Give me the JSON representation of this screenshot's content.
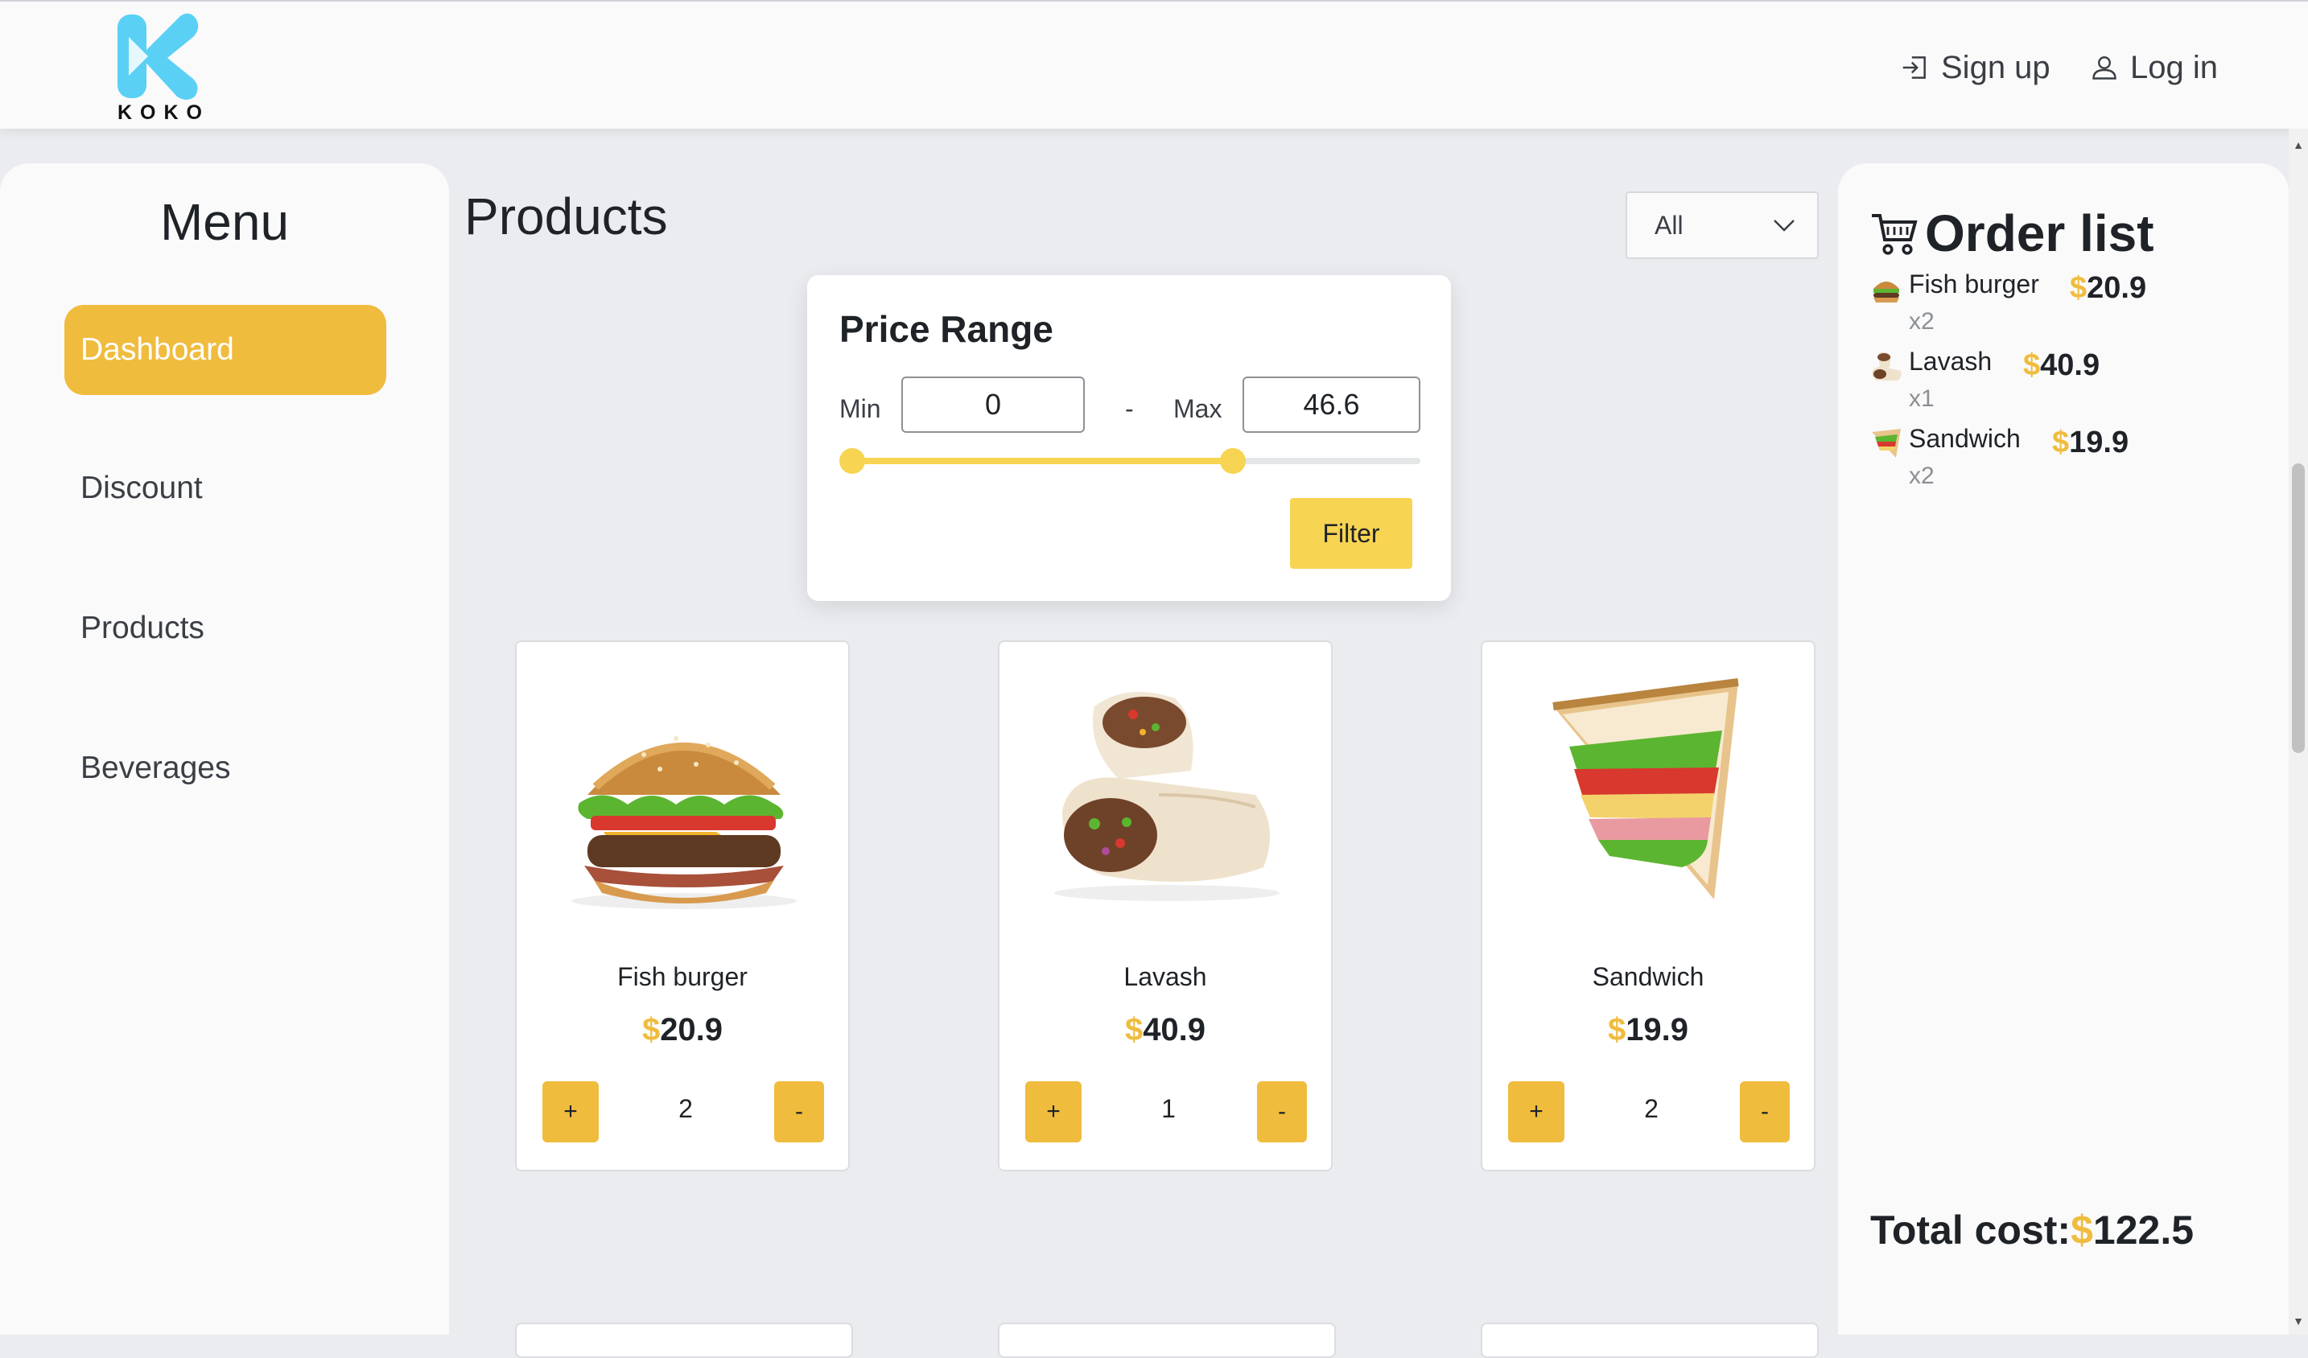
{
  "brand": {
    "name": "KOKO",
    "primary_color": "#5bd0f5",
    "accent": "#f0bc3e"
  },
  "header": {
    "signup_label": "Sign up",
    "login_label": "Log in"
  },
  "sidebar": {
    "title": "Menu",
    "items": [
      {
        "label": "Dashboard",
        "active": true
      },
      {
        "label": "Discount",
        "active": false
      },
      {
        "label": "Products",
        "active": false
      },
      {
        "label": "Beverages",
        "active": false
      }
    ]
  },
  "main": {
    "title": "Products",
    "category_select": {
      "value": "All"
    }
  },
  "price_range": {
    "title": "Price Range",
    "min_label": "Min",
    "max_label": "Max",
    "separator": "-",
    "min_value": "0",
    "max_value": "46.6",
    "slider_fill_fraction": 0.67,
    "filter_label": "Filter"
  },
  "products": [
    {
      "name": "Fish burger",
      "currency": "$",
      "price": "20.9",
      "quantity": "2",
      "plus": "+",
      "minus": "-",
      "icon": "burger"
    },
    {
      "name": "Lavash",
      "currency": "$",
      "price": "40.9",
      "quantity": "1",
      "plus": "+",
      "minus": "-",
      "icon": "wrap"
    },
    {
      "name": "Sandwich",
      "currency": "$",
      "price": "19.9",
      "quantity": "2",
      "plus": "+",
      "minus": "-",
      "icon": "sandwich"
    }
  ],
  "order": {
    "title": "Order list",
    "items": [
      {
        "name": "Fish burger",
        "currency": "$",
        "price": "20.9",
        "qty": "x2"
      },
      {
        "name": "Lavash",
        "currency": "$",
        "price": "40.9",
        "qty": "x1"
      },
      {
        "name": "Sandwich",
        "currency": "$",
        "price": "19.9",
        "qty": "x2"
      }
    ],
    "total_label": "Total cost:",
    "total_currency": "$",
    "total_value": "122.5"
  }
}
